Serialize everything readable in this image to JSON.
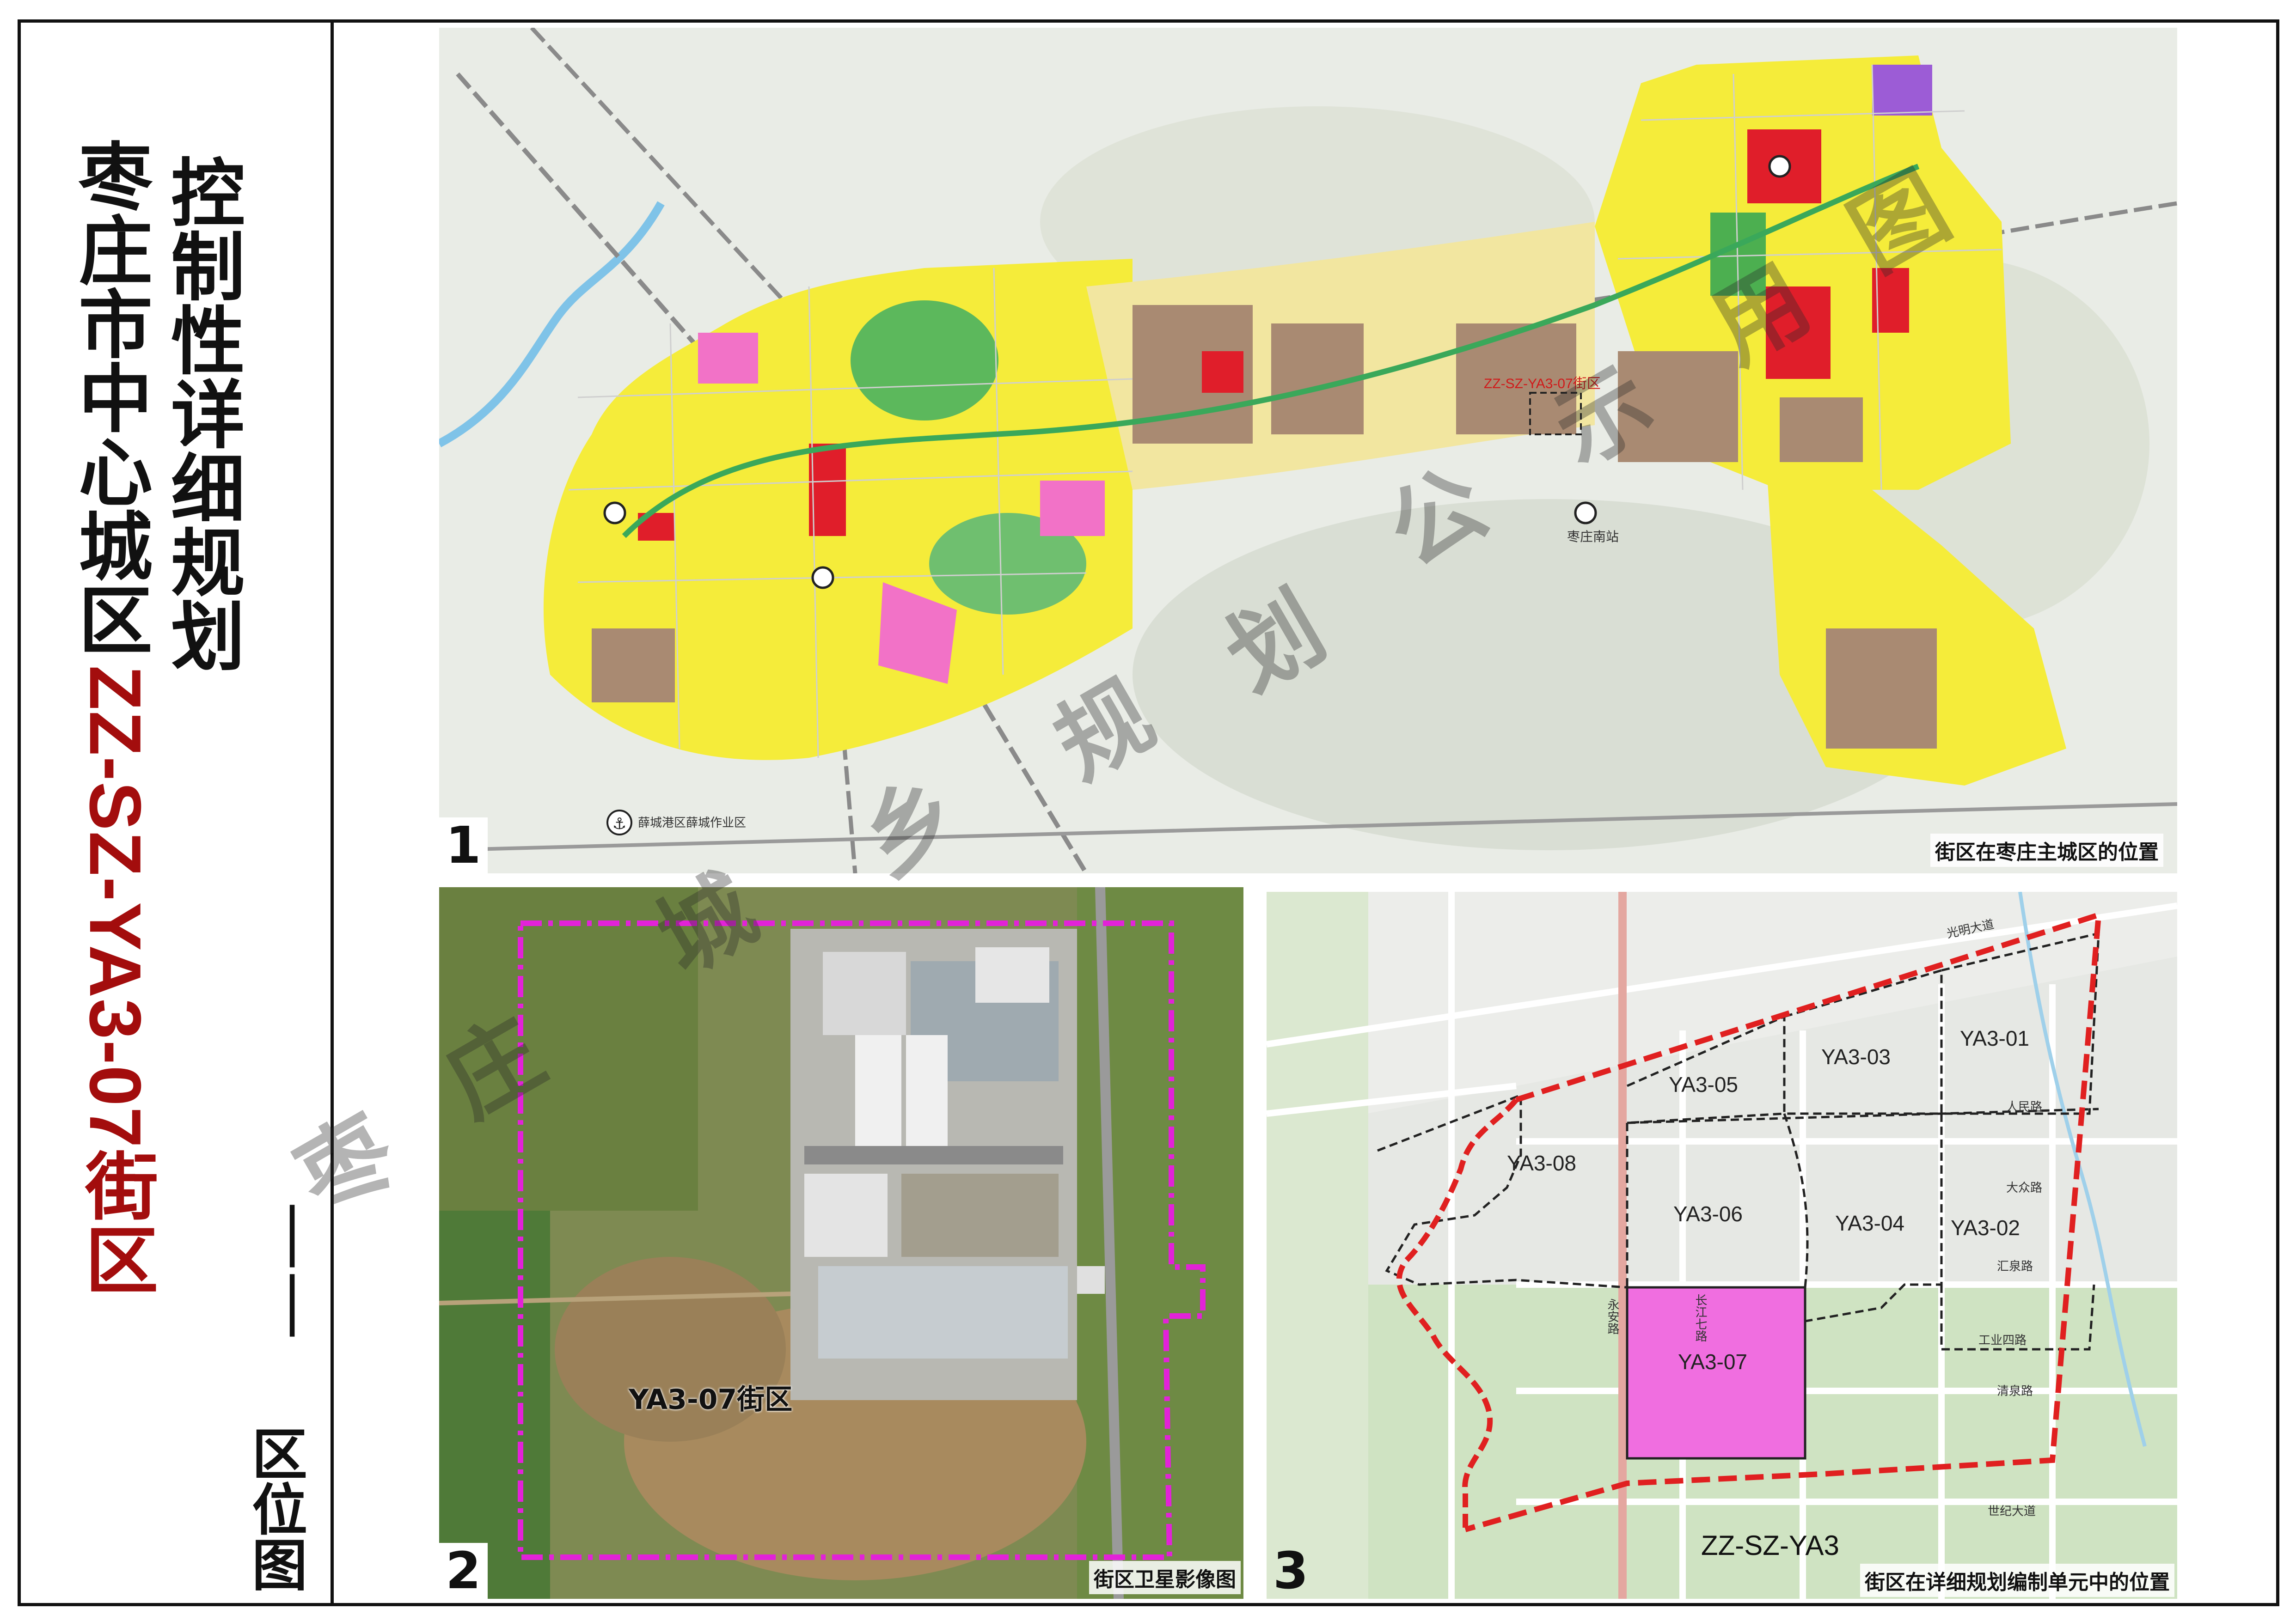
{
  "sidebar": {
    "title_line1": "控制性详细规划",
    "title_line2": "枣庄市中心城区",
    "title_code": "ZZ-SZ-YA3-07街区",
    "subtitle_dash": "——",
    "subtitle": "区位图"
  },
  "watermark": [
    "枣",
    "庄",
    "城",
    "乡",
    "规",
    "划",
    "公",
    "示",
    "用",
    "图"
  ],
  "panel1": {
    "number": "1",
    "caption": "街区在枣庄主城区的位置",
    "target_label": "ZZ-SZ-YA3-07街区",
    "stations": [
      "枣庄南站",
      "薛城港区薛城作业区"
    ],
    "icons": [
      "railway-station-icon",
      "port-anchor-icon"
    ]
  },
  "panel2": {
    "number": "2",
    "caption": "街区卫星影像图",
    "block_label": "YA3-07街区"
  },
  "panel3": {
    "number": "3",
    "caption": "街区在详细规划编制单元中的位置",
    "unit_label": "ZZ-SZ-YA3",
    "blocks": [
      "YA3-01",
      "YA3-02",
      "YA3-03",
      "YA3-04",
      "YA3-05",
      "YA3-06",
      "YA3-07",
      "YA3-08"
    ],
    "roads": [
      "人民路",
      "大众路",
      "汇泉路",
      "工业四路",
      "清泉路",
      "世纪大道",
      "长江七路",
      "永安路",
      "光明大道"
    ]
  },
  "colors": {
    "border": "#111111",
    "title_black": "#111111",
    "title_red": "#a30d0d",
    "target_magenta": "#e0249e",
    "boundary_red": "#e02020",
    "residential_yellow": "#f5ec3a",
    "industrial_brown": "#a98a72",
    "commercial_red": "#e01e2a",
    "green_space": "#4caf50",
    "target_fill": "#f06ee0"
  }
}
